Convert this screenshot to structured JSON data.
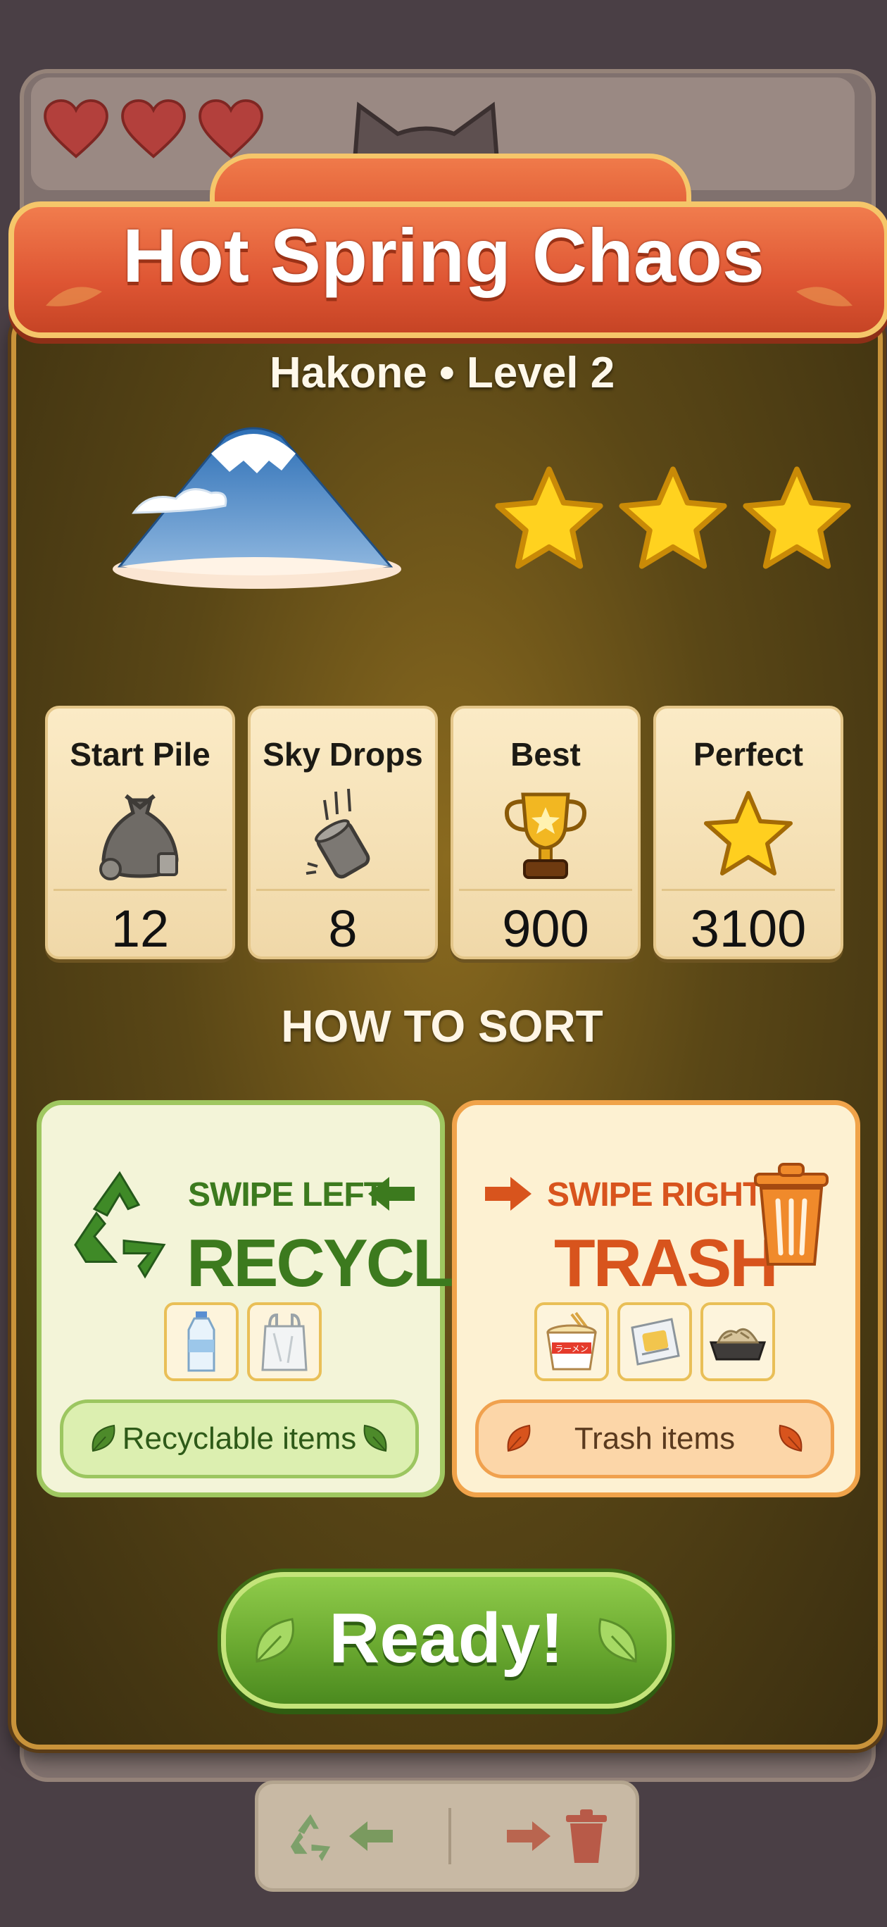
{
  "hud": {
    "hearts": 3
  },
  "modal": {
    "title": "Hot Spring Chaos",
    "subtitle": "Hakone • Level 2",
    "stars_earned": 3,
    "stats": [
      {
        "label": "Start Pile",
        "value": "12",
        "icon": "trash-bag-icon"
      },
      {
        "label": "Sky Drops",
        "value": "8",
        "icon": "falling-can-icon"
      },
      {
        "label": "Best",
        "value": "900",
        "icon": "trophy-icon"
      },
      {
        "label": "Perfect",
        "value": "3100",
        "icon": "star-icon"
      }
    ],
    "how_to_sort": "HOW TO SORT",
    "recycle": {
      "direction": "SWIPE LEFT",
      "action": "RECYCLE",
      "pill": "Recyclable items",
      "items": [
        "water-bottle-icon",
        "plastic-bag-icon"
      ],
      "color": "#3c7a1e"
    },
    "trash": {
      "direction": "SWIPE RIGHT",
      "action": "TRASH",
      "pill": "Trash items",
      "items": [
        "noodle-cup-icon",
        "snack-wrapper-icon",
        "food-tray-icon"
      ],
      "cup_text": "ラーメン",
      "color": "#d8541d"
    },
    "ready": "Ready!"
  }
}
